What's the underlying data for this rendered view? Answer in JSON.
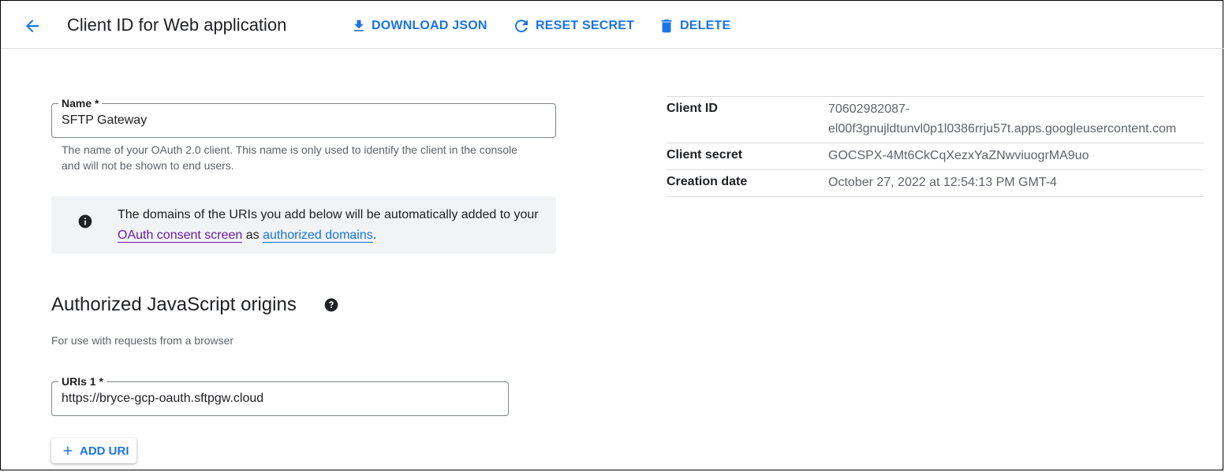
{
  "header": {
    "title": "Client ID for Web application",
    "actions": {
      "download": "DOWNLOAD JSON",
      "reset": "RESET SECRET",
      "delete": "DELETE"
    }
  },
  "form": {
    "name": {
      "label": "Name *",
      "value": "SFTP Gateway",
      "hint": "The name of your OAuth 2.0 client. This name is only used to identify the client in the console and will not be shown to end users."
    },
    "info": {
      "text_before": "The domains of the URIs you add below will be automatically added to your ",
      "link1": "OAuth consent screen",
      "text_middle": " as ",
      "link2": "authorized domains",
      "text_after": "."
    },
    "origins": {
      "title": "Authorized JavaScript origins",
      "subtitle": "For use with requests from a browser",
      "uri_label": "URIs 1 *",
      "uri_value": "https://bryce-gcp-oauth.sftpgw.cloud",
      "add_label": "ADD URI"
    }
  },
  "details": {
    "client_id_label": "Client ID",
    "client_id_value": "70602982087-el00f3gnujldtunvl0p1l0386rrju57t.apps.googleusercontent.com",
    "secret_label": "Client secret",
    "secret_value": "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",
    "date_label": "Creation date",
    "date_value": "October 27, 2022 at 12:54:13 PM GMT-4"
  },
  "colors": {
    "accent": "#1a73e8",
    "visited_link": "#681da8",
    "info_bg": "#f1f3f4"
  }
}
